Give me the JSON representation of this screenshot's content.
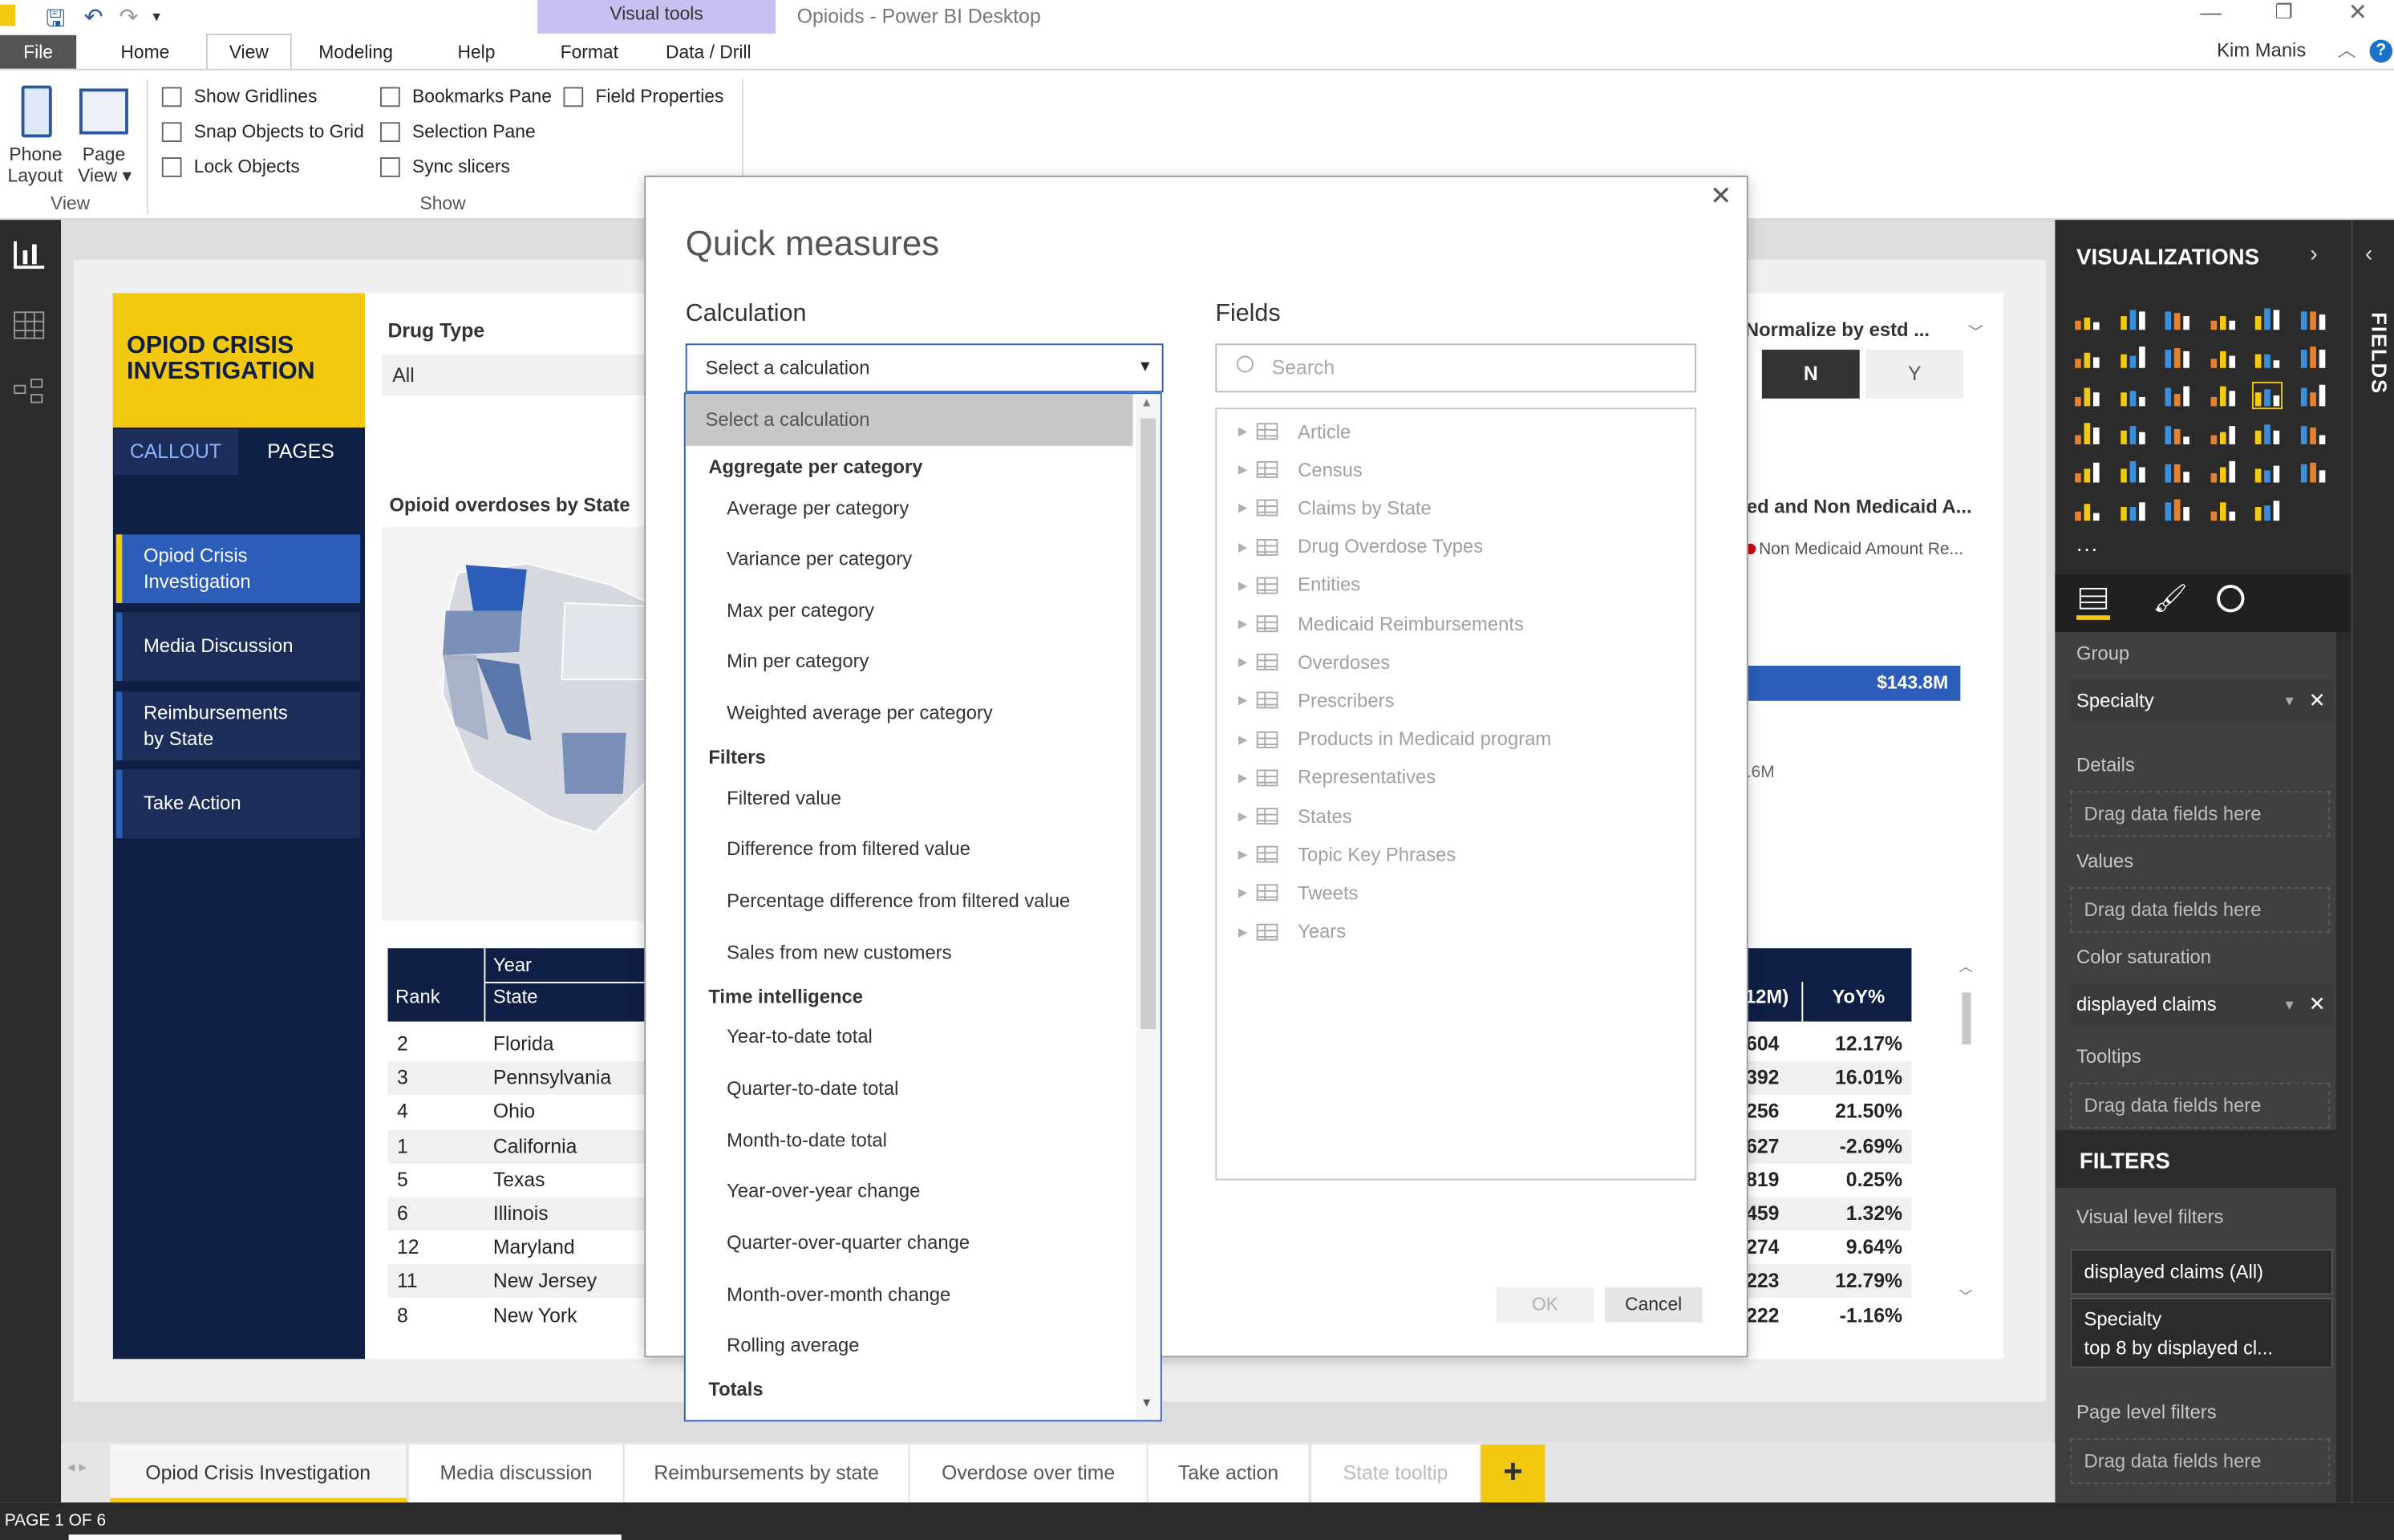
{
  "titlebar": {
    "visual_tools": "Visual tools",
    "title": "Opioids - Power BI Desktop",
    "user": "Kim Manis"
  },
  "ribbon": {
    "tabs": [
      "File",
      "Home",
      "View",
      "Modeling",
      "Help",
      "Format",
      "Data / Drill"
    ],
    "phone_layout": [
      "Phone",
      "Layout"
    ],
    "page_view": [
      "Page",
      "View ▾"
    ],
    "view_group": "View",
    "show_group": "Show",
    "checks": [
      "Show Gridlines",
      "Snap Objects to Grid",
      "Lock Objects",
      "Bookmarks Pane",
      "Selection Pane",
      "Sync slicers",
      "Field Properties"
    ]
  },
  "report": {
    "logo": "OPIOD CRISIS INVESTIGATION",
    "callout": "CALLOUT",
    "pages": "PAGES",
    "nav": [
      "Opiod Crisis Investigation",
      "Media Discussion",
      "Reimbursements by State",
      "Take Action"
    ],
    "drug_type_label": "Drug Type",
    "drug_type_value": "All",
    "map_title": "Opioid overdoses by State",
    "normalize_label": "Normalize by estd ...",
    "normalize_n": "N",
    "normalize_y": "Y",
    "bar_title": "ed and Non Medicaid A...",
    "bar_legend": "Non Medicaid Amount Re...",
    "bar_value": "$143.8M",
    "bar_value2": ".6M",
    "table": {
      "year": "Year",
      "rank": "Rank",
      "state": "State",
      "col12m": "12M)",
      "yoy": "YoY%",
      "rows": [
        [
          "2",
          "Florida",
          ",604",
          "12.17%"
        ],
        [
          "3",
          "Pennsylvania",
          ",392",
          "16.01%"
        ],
        [
          "4",
          "Ohio",
          ",256",
          "21.50%"
        ],
        [
          "1",
          "California",
          ",627",
          "-2.69%"
        ],
        [
          "5",
          "Texas",
          ",819",
          "0.25%"
        ],
        [
          "6",
          "Illinois",
          ",459",
          "1.32%"
        ],
        [
          "12",
          "Maryland",
          ",274",
          "9.64%"
        ],
        [
          "11",
          "New Jersey",
          ",223",
          "12.79%"
        ],
        [
          "8",
          "New York",
          ",222",
          "-1.16%"
        ]
      ]
    }
  },
  "dialog": {
    "title": "Quick measures",
    "calc_label": "Calculation",
    "fields_label": "Fields",
    "select_value": "Select a calculation",
    "search_placeholder": "Search",
    "list_selected": "Select a calculation",
    "groups": [
      {
        "header": "Aggregate per category",
        "items": [
          "Average per category",
          "Variance per category",
          "Max per category",
          "Min per category",
          "Weighted average per category"
        ]
      },
      {
        "header": "Filters",
        "items": [
          "Filtered value",
          "Difference from filtered value",
          "Percentage difference from filtered value",
          "Sales from new customers"
        ]
      },
      {
        "header": "Time intelligence",
        "items": [
          "Year-to-date total",
          "Quarter-to-date total",
          "Month-to-date total",
          "Year-over-year change",
          "Quarter-over-quarter change",
          "Month-over-month change",
          "Rolling average"
        ]
      },
      {
        "header": "Totals",
        "items": []
      }
    ],
    "fields": [
      "Article",
      "Census",
      "Claims by State",
      "Drug Overdose Types",
      "Entities",
      "Medicaid Reimbursements",
      "Overdoses",
      "Prescribers",
      "Products in Medicaid program",
      "Representatives",
      "States",
      "Topic Key Phrases",
      "Tweets",
      "Years"
    ],
    "ok": "OK",
    "cancel": "Cancel"
  },
  "viz": {
    "title": "VISUALIZATIONS",
    "fields_tab": "FIELDS",
    "more": "...",
    "wells": [
      {
        "label": "Group",
        "pill": "Specialty"
      },
      {
        "label": "Details",
        "empty": "Drag data fields here"
      },
      {
        "label": "Values",
        "empty": "Drag data fields here"
      },
      {
        "label": "Color saturation",
        "pill": "displayed claims"
      },
      {
        "label": "Tooltips",
        "empty": "Drag data fields here"
      }
    ],
    "filters_title": "FILTERS",
    "visual_filters": "Visual level filters",
    "filter1": "displayed claims (All)",
    "filter2a": "Specialty",
    "filter2b": "top 8 by displayed cl...",
    "page_filters": "Page level filters",
    "page_drag": "Drag data fields here"
  },
  "pagetabs": [
    "Opiod Crisis Investigation",
    "Media discussion",
    "Reimbursements by state",
    "Overdose over time",
    "Take action",
    "State tooltip"
  ],
  "status": "PAGE 1 OF 6",
  "colors": {
    "accent": "#f2c811",
    "navy": "#0f1e44",
    "blue": "#2c5db8"
  }
}
